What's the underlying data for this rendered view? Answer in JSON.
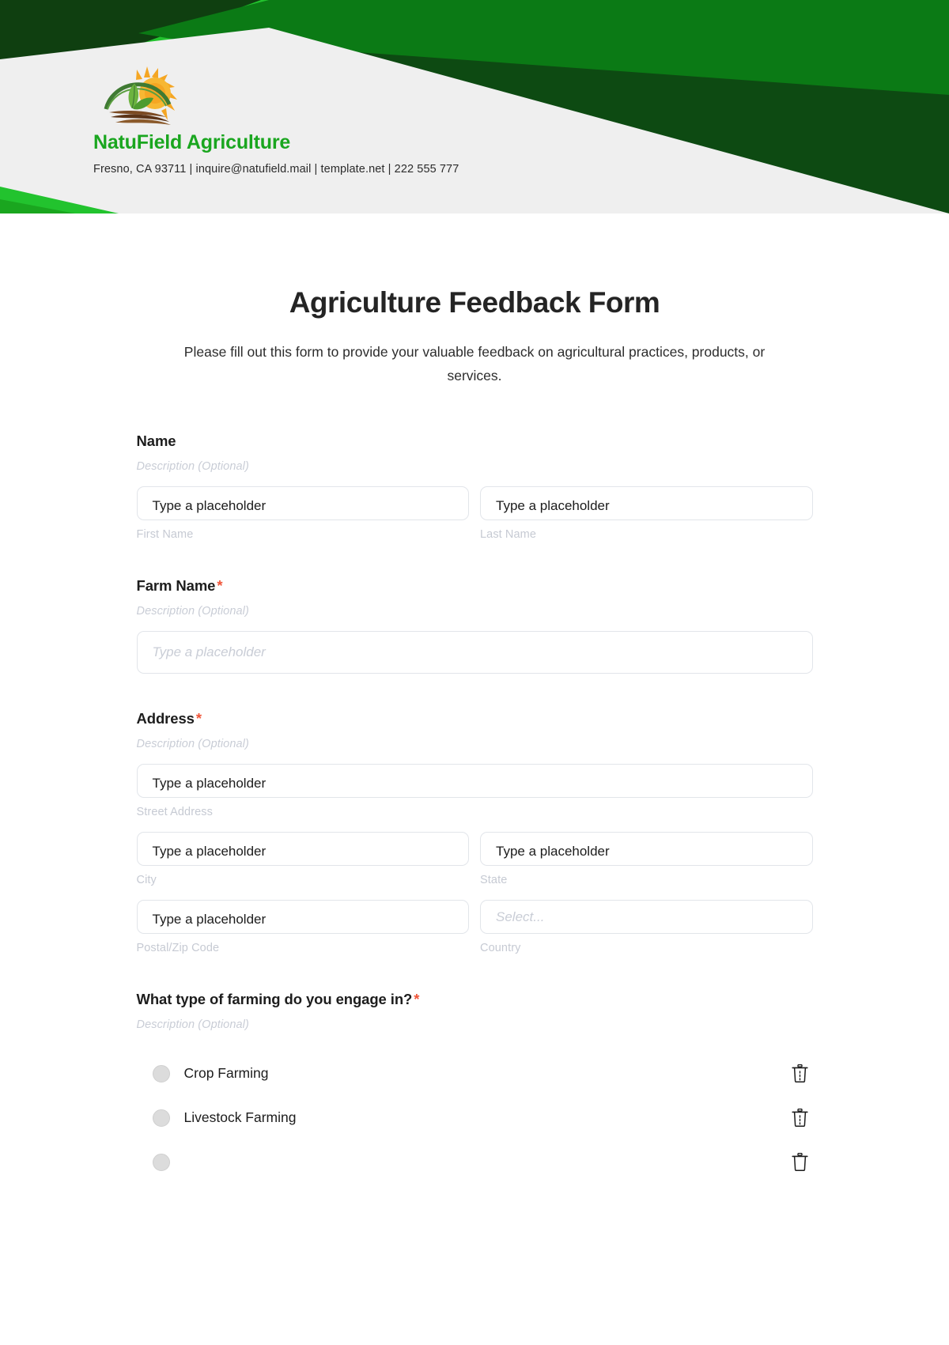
{
  "brand": {
    "name": "NatuField Agriculture",
    "contact": "Fresno, CA 93711  | inquire@natufield.mail  | template.net  | 222 555 777",
    "logo_icon": "sunrise-field-leaves-logo",
    "colors": {
      "bright_green": "#22c32e",
      "mid_green": "#0b7a15",
      "dark_green": "#0d4a12",
      "panel_gray": "#efefef",
      "wordmark_green": "#1aa61f",
      "required_red": "#f0563a"
    }
  },
  "form": {
    "title": "Agriculture Feedback Form",
    "subtitle": "Please fill out this form to provide your valuable feedback on agricultural practices, products, or services.",
    "description_placeholder": "Description (Optional)",
    "required_marker": "*",
    "text_placeholder": "Type a placeholder",
    "select_placeholder": "Select...",
    "fields": [
      {
        "label": "Name",
        "required": false,
        "description": "Description (Optional)",
        "rows": [
          [
            {
              "placeholder": "Type a placeholder",
              "sub_label": "First Name",
              "type": "text"
            },
            {
              "placeholder": "Type a placeholder",
              "sub_label": "Last Name",
              "type": "text"
            }
          ]
        ]
      },
      {
        "label": "Farm Name",
        "required": true,
        "description": "Description (Optional)",
        "rows": [
          [
            {
              "placeholder": "Type a placeholder",
              "sub_label": "",
              "type": "text-muted"
            }
          ]
        ]
      },
      {
        "label": "Address",
        "required": true,
        "description": "Description (Optional)",
        "rows": [
          [
            {
              "placeholder": "Type a placeholder",
              "sub_label": "Street Address",
              "type": "text"
            }
          ],
          [
            {
              "placeholder": "Type a placeholder",
              "sub_label": "City",
              "type": "text"
            },
            {
              "placeholder": "Type a placeholder",
              "sub_label": "State",
              "type": "text"
            }
          ],
          [
            {
              "placeholder": "Type a placeholder",
              "sub_label": "Postal/Zip Code",
              "type": "text"
            },
            {
              "placeholder": "Select...",
              "sub_label": "Country",
              "type": "select"
            }
          ]
        ]
      }
    ],
    "choice_question": {
      "label": "What type of farming do you engage in?",
      "required": true,
      "description": "Description (Optional)",
      "input_type": "radio",
      "options": [
        {
          "label": "Crop Farming",
          "delete_icon": "trash-icon"
        },
        {
          "label": "Livestock Farming",
          "delete_icon": "trash-icon"
        },
        {
          "label": "",
          "delete_icon": "trash-icon"
        }
      ]
    }
  }
}
